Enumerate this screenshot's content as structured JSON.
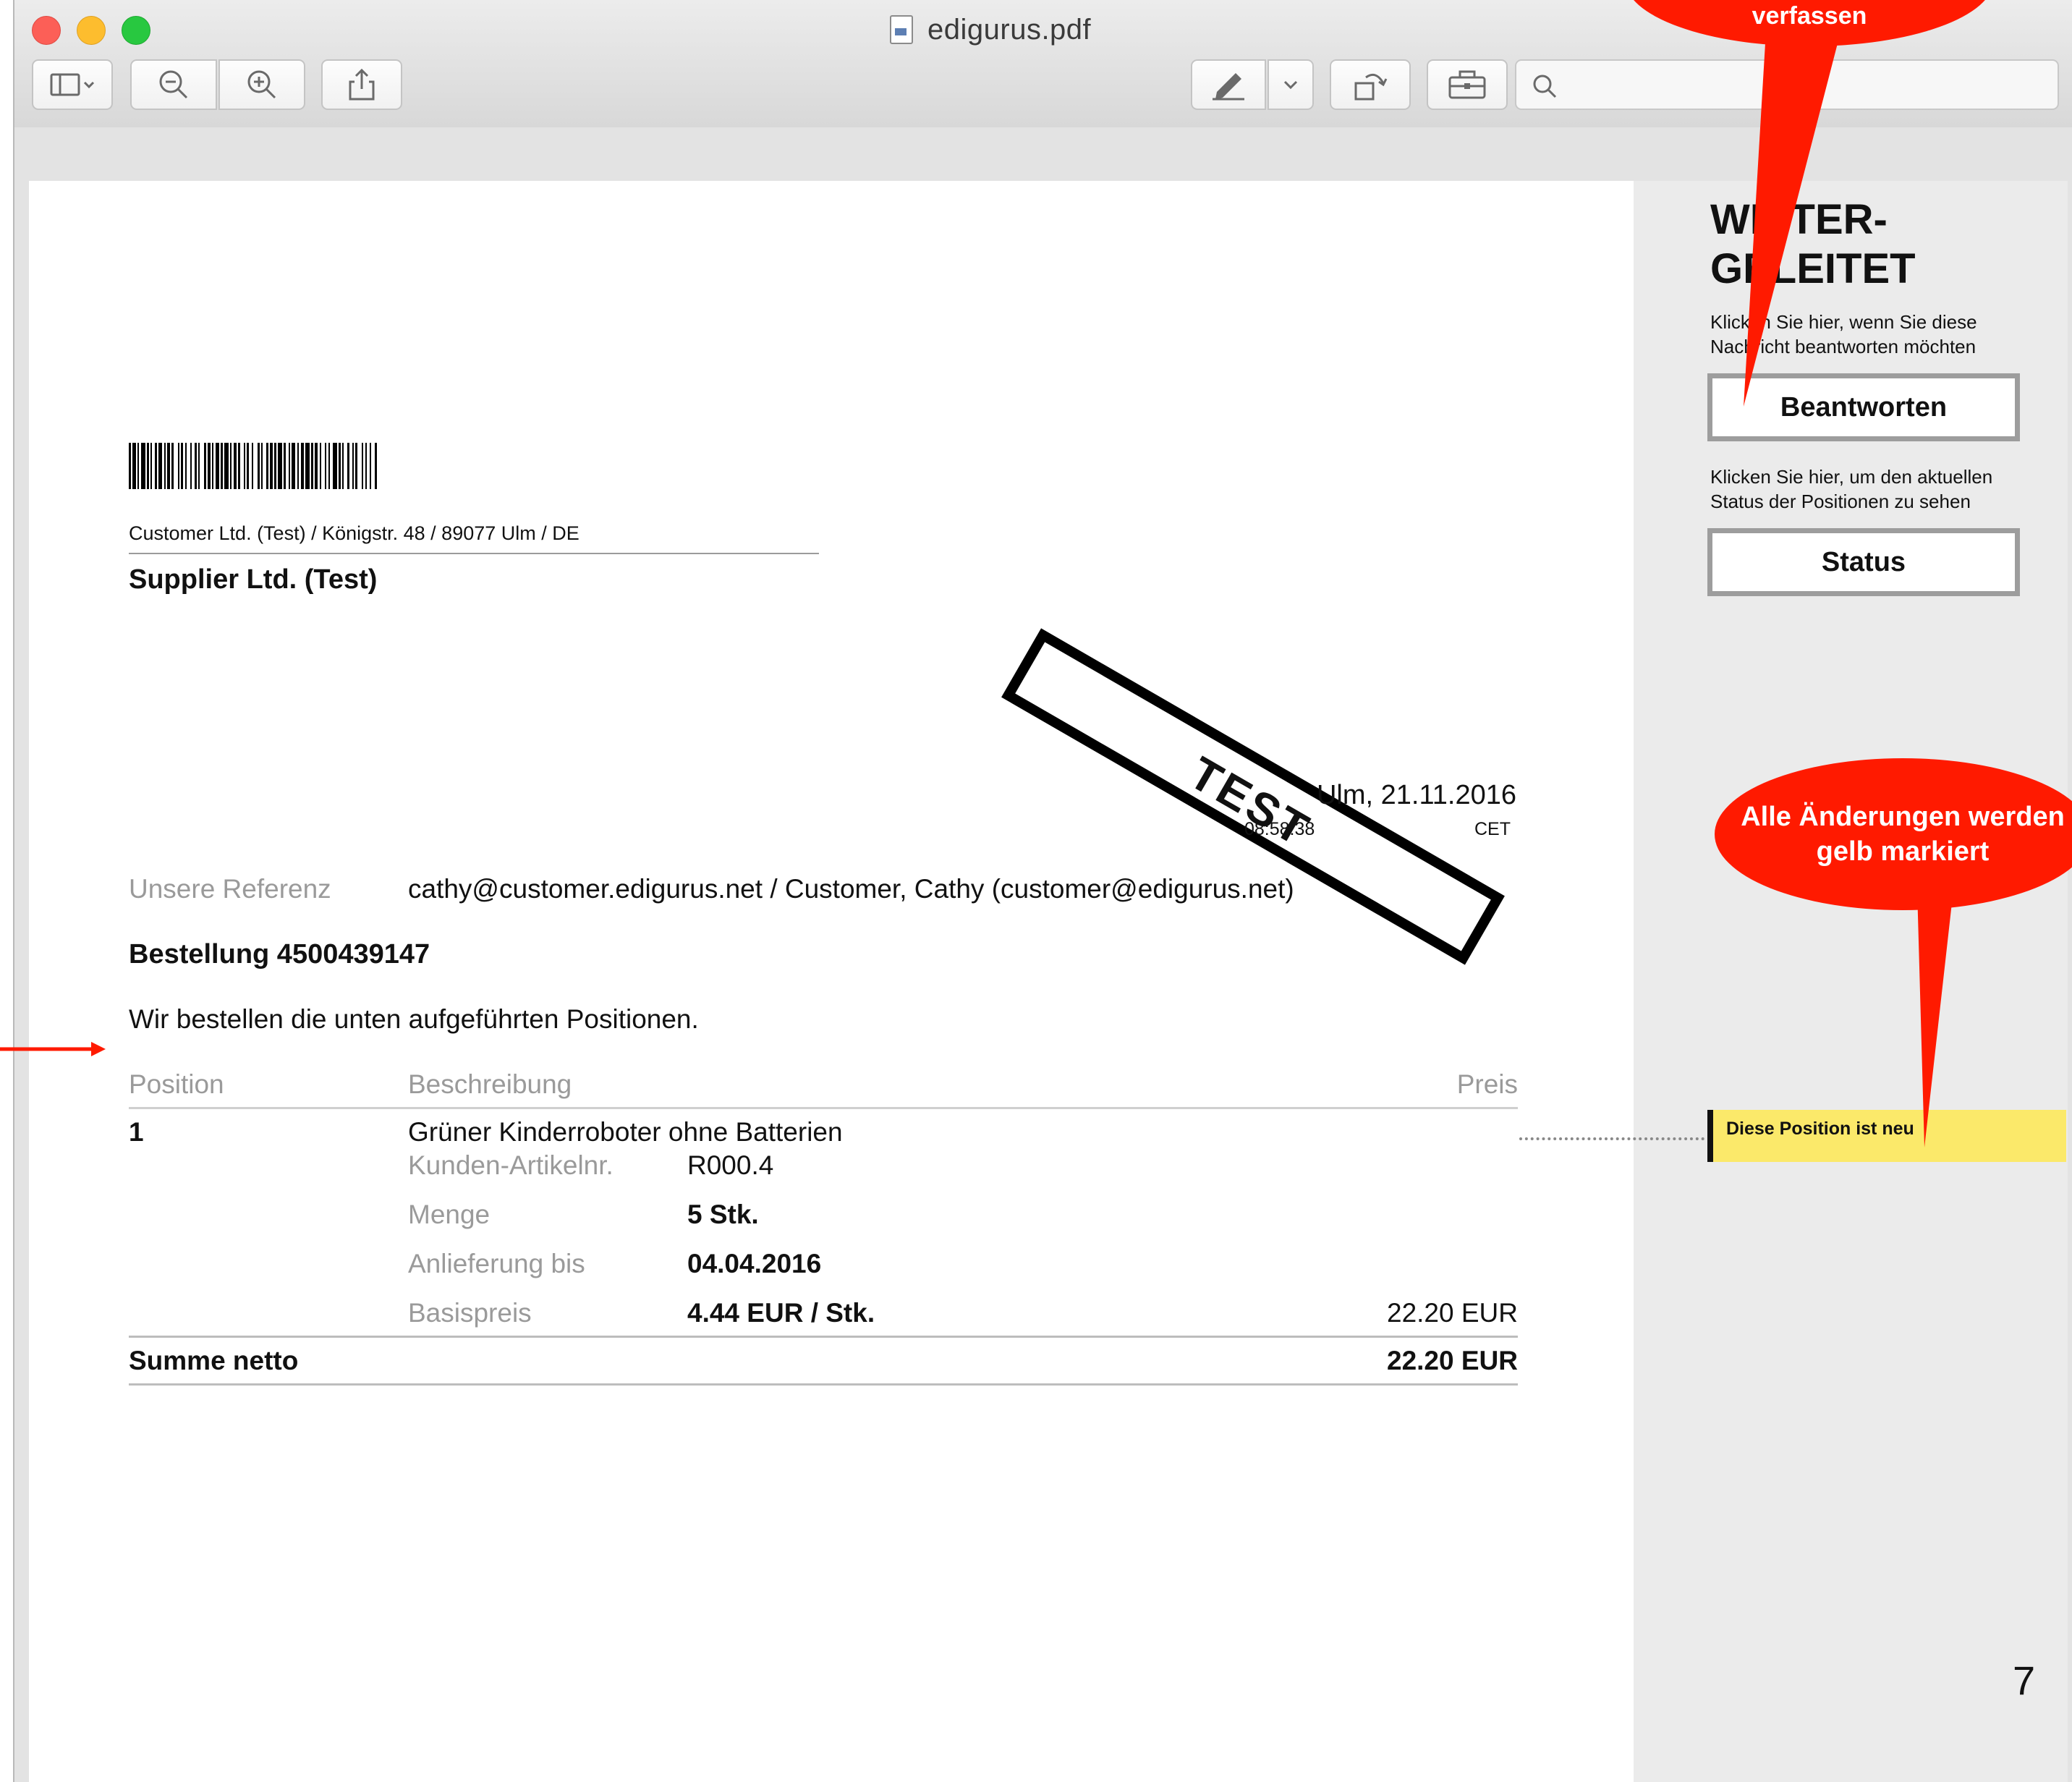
{
  "window": {
    "title": "edigurus.pdf"
  },
  "toolbar": {
    "buttons": [
      {
        "name": "sidebar-toggle",
        "icon": "sidebar-icon"
      },
      {
        "name": "zoom-out",
        "icon": "zoom-out-icon"
      },
      {
        "name": "zoom-in",
        "icon": "zoom-in-icon"
      },
      {
        "name": "share",
        "icon": "share-icon"
      },
      {
        "name": "markup",
        "icon": "pen-icon"
      },
      {
        "name": "rotate",
        "icon": "rotate-icon"
      },
      {
        "name": "toolbox",
        "icon": "toolbox-icon"
      }
    ],
    "search_placeholder": ""
  },
  "document": {
    "sender_line": "Customer Ltd. (Test) / Königstr. 48 / 89077 Ulm / DE",
    "recipient": "Supplier Ltd. (Test)",
    "stamp": "TEST",
    "date": "Ulm, 21.11.2016",
    "time": "08:58:38",
    "timezone": "CET",
    "reference_label": "Unsere Referenz",
    "reference_value": "cathy@customer.edigurus.net / Customer, Cathy (customer@edigurus.net)",
    "order_title": "Bestellung 4500439147",
    "intro": "Wir bestellen die unten aufgeführten Positionen.",
    "table": {
      "headers": {
        "position": "Position",
        "description": "Beschreibung",
        "price": "Preis"
      },
      "rows": [
        {
          "position": "1",
          "description": "Grüner Kinderroboter ohne Batterien",
          "details": [
            {
              "label": "Kunden-Artikelnr.",
              "value": "R000.4",
              "bold": false
            },
            {
              "label": "Menge",
              "value": "5 Stk.",
              "bold": true
            },
            {
              "label": "Anlieferung bis",
              "value": "04.04.2016",
              "bold": true
            },
            {
              "label": "Basispreis",
              "value": "4.44 EUR / Stk.",
              "bold": true
            }
          ],
          "price": "22.20 EUR"
        }
      ],
      "total_label": "Summe netto",
      "total_value": "22.20 EUR"
    },
    "page_number": "7"
  },
  "sidebar": {
    "heading_line1": "WEITER-",
    "heading_line2": "GELEITET",
    "reply_text": "Klicken Sie hier, wenn Sie diese Nachricht beantworten möchten",
    "reply_button": "Beantworten",
    "status_text": "Klicken Sie hier, um den aktuellen Status der Positionen zu sehen",
    "status_button": "Status",
    "change_note": "Diese Position ist neu"
  },
  "annotations": {
    "top_bubble": "verfassen",
    "bottom_bubble": "Alle Änderungen werden gelb markiert",
    "color": "#ff1a00"
  },
  "colors": {
    "highlight_yellow": "#fbe96a",
    "label_gray": "#9a9a9a"
  }
}
